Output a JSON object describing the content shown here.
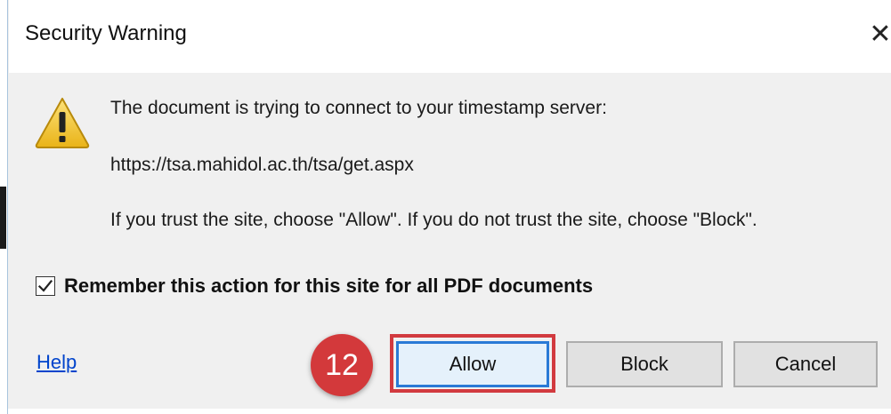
{
  "window": {
    "title": "Security Warning",
    "close_glyph": "✕"
  },
  "message": {
    "line1": "The document is trying to connect to your timestamp server:",
    "url": "https://tsa.mahidol.ac.th/tsa/get.aspx",
    "line3": "If you trust the site, choose \"Allow\".  If you do not trust the site, choose \"Block\"."
  },
  "remember": {
    "label": "Remember this action for this site for all PDF documents",
    "checked": true
  },
  "footer": {
    "help_label": "Help",
    "step_number": "12",
    "allow_label": "Allow",
    "block_label": "Block",
    "cancel_label": "Cancel"
  },
  "colors": {
    "highlight": "#d23a3f",
    "badge": "#d3393b",
    "link": "#0044cc",
    "focus": "#2a7ad6"
  },
  "icons": {
    "warning": "warning-triangle-icon",
    "close": "close-icon",
    "check": "checkmark-icon"
  }
}
